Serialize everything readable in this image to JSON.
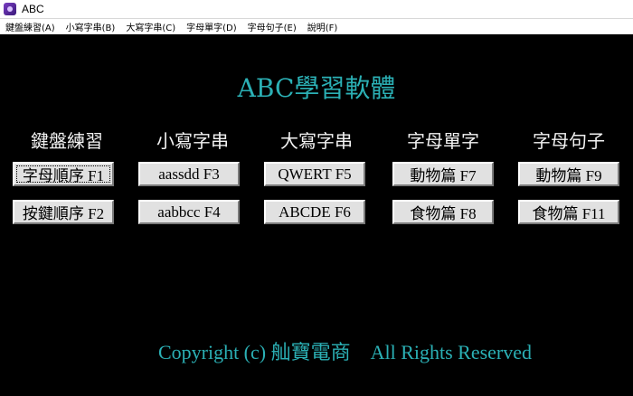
{
  "window": {
    "title": "ABC"
  },
  "menu": {
    "items": [
      "鍵盤練習(A)",
      "小寫字串(B)",
      "大寫字串(C)",
      "字母單字(D)",
      "字母句子(E)",
      "說明(F)"
    ]
  },
  "main": {
    "app_title": "ABC學習軟體",
    "columns": [
      {
        "header": "鍵盤練習",
        "buttons": [
          "字母順序 F1",
          "按鍵順序 F2"
        ]
      },
      {
        "header": "小寫字串",
        "buttons": [
          "aassdd F3",
          "aabbcc F4"
        ]
      },
      {
        "header": "大寫字串",
        "buttons": [
          "QWERT F5",
          "ABCDE  F6"
        ]
      },
      {
        "header": "字母單字",
        "buttons": [
          "動物篇 F7",
          "食物篇 F8"
        ]
      },
      {
        "header": "字母句子",
        "buttons": [
          "動物篇  F9",
          "食物篇 F11"
        ]
      }
    ],
    "copyright": "Copyright (c) 舢寶電商　All Rights Reserved"
  },
  "colors": {
    "background": "#000000",
    "accent_teal": "#2bb0b5",
    "header_text": "#f2f2f2",
    "button_face": "#e1e1e1"
  },
  "icons": {
    "app_icon": "app-icon"
  }
}
